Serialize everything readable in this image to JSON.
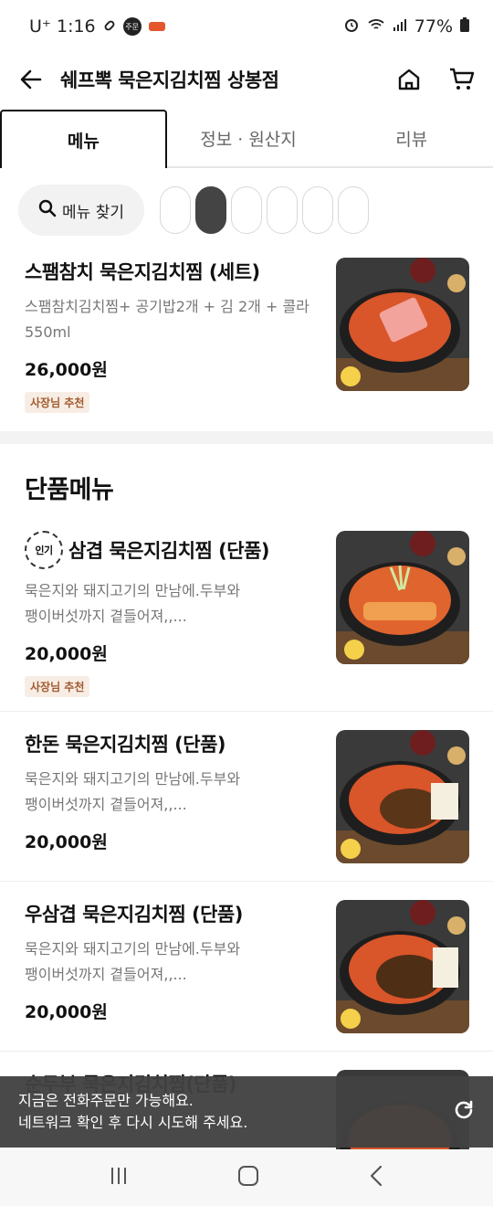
{
  "status_bar": {
    "carrier": "U⁺ 1:16",
    "badge": "주문",
    "battery": "77%"
  },
  "header": {
    "title": "쉐프뽁 묵은지김치찜 상봉점"
  },
  "tabs": [
    {
      "label": "메뉴",
      "active": true
    },
    {
      "label": "정보 · 원산지",
      "active": false
    },
    {
      "label": "리뷰",
      "active": false
    }
  ],
  "search": {
    "label": "메뉴 찾기"
  },
  "items_top": [
    {
      "name": "스팸참치 묵은지김치찜 (세트)",
      "desc1": "스팸참치김치찜+ 공기밥2개 + 김 2개 + 콜라",
      "desc2": "550ml",
      "price": "26,000원",
      "badge": "사장님 추천"
    }
  ],
  "section": {
    "title": "단품메뉴"
  },
  "items": [
    {
      "popular_label": "인기",
      "name": "삼겹 묵은지김치찜 (단품)",
      "desc1": "묵은지와 돼지고기의 만남에.두부와",
      "desc2": "팽이버섯까지 곁들어져,,...",
      "price": "20,000원",
      "badge": "사장님 추천"
    },
    {
      "name": "한돈 묵은지김치찜 (단품)",
      "desc1": "묵은지와 돼지고기의 만남에.두부와",
      "desc2": "팽이버섯까지 곁들어져,,...",
      "price": "20,000원"
    },
    {
      "name": "우삼겹 묵은지김치찜 (단품)",
      "desc1": "묵은지와 돼지고기의 만남에.두부와",
      "desc2": "팽이버섯까지 곁들어져,,...",
      "price": "20,000원"
    },
    {
      "name": "순두부 묵은지김치찜(단품)"
    }
  ],
  "toast": {
    "line1": "지금은 전화주문만 가능해요.",
    "line2": "네트워크 확인 후 다시 시도해 주세요."
  },
  "colors": {
    "accent": "#111111",
    "badge_bg": "#f8ede4",
    "badge_text": "#a15a2f"
  }
}
